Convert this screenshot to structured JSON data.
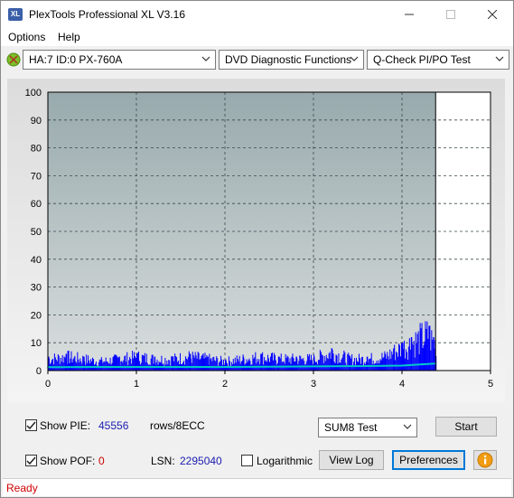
{
  "window": {
    "title": "PlexTools Professional XL V3.16",
    "icon_text": "XL",
    "controls": [
      "minimize-icon",
      "maximize-icon",
      "close-icon"
    ]
  },
  "menu": {
    "options": "Options",
    "help": "Help"
  },
  "toolbar": {
    "drive": "HA:7 ID:0  PX-760A",
    "function": "DVD Diagnostic Functions",
    "test": "Q-Check PI/PO Test"
  },
  "colors": {
    "bar": "#0000ff",
    "line": "#00c8c8",
    "plot_bg_top": "#98aaad",
    "plot_bg_bottom": "#dadede",
    "status_text": "#d00000"
  },
  "chart_data": {
    "type": "bar",
    "title": "",
    "xlabel": "",
    "ylabel": "",
    "xlim": [
      0,
      5
    ],
    "ylim": [
      0,
      100
    ],
    "x_ticks": [
      "0",
      "1",
      "2",
      "3",
      "4",
      "5"
    ],
    "y_ticks": [
      "0",
      "10",
      "20",
      "30",
      "40",
      "50",
      "60",
      "70",
      "80",
      "90",
      "100"
    ],
    "grid": true,
    "data_end_x": 4.38,
    "series": [
      {
        "kind": "bars",
        "color": "#0000ff",
        "x": [
          0.0,
          0.2,
          0.4,
          0.6,
          0.8,
          1.0,
          1.2,
          1.4,
          1.6,
          1.8,
          2.0,
          2.2,
          2.4,
          2.6,
          2.8,
          3.0,
          3.2,
          3.4,
          3.6,
          3.8,
          3.9,
          4.0,
          4.1,
          4.2,
          4.3,
          4.35
        ],
        "values": [
          5,
          6,
          5,
          4,
          5,
          6,
          5,
          5,
          6,
          5,
          4,
          5,
          6,
          5,
          5,
          5,
          8,
          5,
          5,
          6,
          8,
          10,
          12,
          14,
          16,
          12
        ]
      },
      {
        "kind": "line",
        "color": "#00c8c8",
        "x": [
          0.0,
          0.5,
          1.0,
          1.5,
          2.0,
          2.5,
          3.0,
          3.5,
          4.0,
          4.2,
          4.38
        ],
        "values": [
          1.2,
          1.3,
          1.3,
          1.3,
          1.3,
          1.4,
          1.5,
          1.6,
          1.8,
          2.2,
          2.5
        ]
      }
    ]
  },
  "controls": {
    "show_pie_label": "Show PIE:",
    "pie_value": "45556",
    "pie_unit": "rows/8ECC",
    "show_pof_label": "Show POF:",
    "pof_value": "0",
    "lsn_label": "LSN:",
    "lsn_value": "2295040",
    "logarithmic_label": "Logarithmic",
    "sum_select": "SUM8 Test",
    "start_button": "Start",
    "view_log_button": "View Log",
    "preferences_button": "Preferences"
  },
  "status": {
    "text": "Ready"
  }
}
